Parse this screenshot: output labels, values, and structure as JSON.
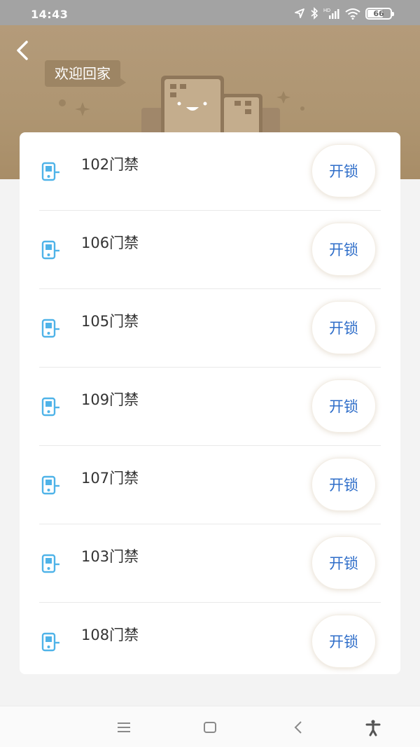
{
  "status_bar": {
    "time": "14:43",
    "battery": "66",
    "network": "HD"
  },
  "header": {
    "welcome": "欢迎回家",
    "back_icon": "chevron-left-icon"
  },
  "doors": [
    {
      "name": "102门禁",
      "action": "开锁"
    },
    {
      "name": "106门禁",
      "action": "开锁"
    },
    {
      "name": "105门禁",
      "action": "开锁"
    },
    {
      "name": "109门禁",
      "action": "开锁"
    },
    {
      "name": "107门禁",
      "action": "开锁"
    },
    {
      "name": "103门禁",
      "action": "开锁"
    },
    {
      "name": "108门禁",
      "action": "开锁"
    }
  ],
  "colors": {
    "header": "#ae9571",
    "accent": "#2f6ec9",
    "icon": "#4fb3e8"
  },
  "nav_bar": {
    "icons": [
      "menu-icon",
      "home-square-icon",
      "back-triangle-icon",
      "accessibility-icon"
    ]
  }
}
